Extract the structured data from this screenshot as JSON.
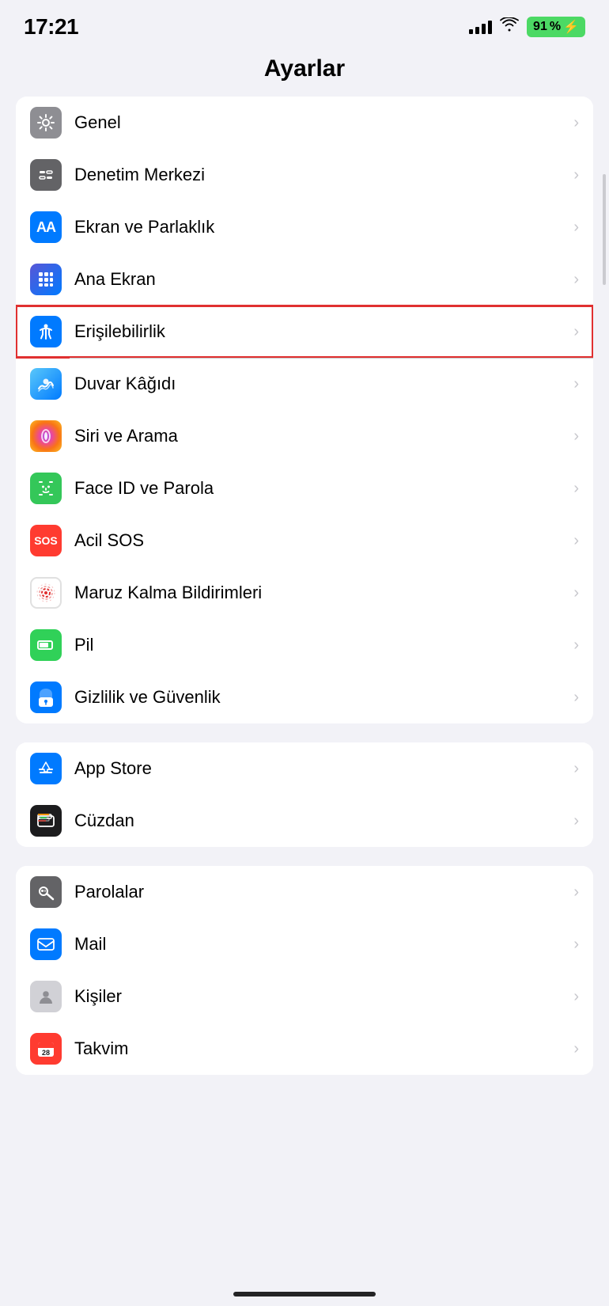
{
  "statusBar": {
    "time": "17:21",
    "battery": "91",
    "batteryIcon": "⚡"
  },
  "pageTitle": "Ayarlar",
  "sections": [
    {
      "id": "section1",
      "items": [
        {
          "id": "genel",
          "label": "Genel",
          "iconBg": "bg-gray",
          "iconType": "gear",
          "highlighted": false
        },
        {
          "id": "denetim-merkezi",
          "label": "Denetim Merkezi",
          "iconBg": "bg-gray2",
          "iconType": "toggles",
          "highlighted": false
        },
        {
          "id": "ekran-parlaklik",
          "label": "Ekran ve Parlaklık",
          "iconBg": "bg-blue",
          "iconType": "aa",
          "highlighted": false
        },
        {
          "id": "ana-ekran",
          "label": "Ana Ekran",
          "iconBg": "bg-blue2",
          "iconType": "grid",
          "highlighted": false
        },
        {
          "id": "erisilebilirlik",
          "label": "Erişilebilirlik",
          "iconBg": "bg-blue",
          "iconType": "accessibility",
          "highlighted": true
        },
        {
          "id": "duvar-kagidi",
          "label": "Duvar Kâğıdı",
          "iconBg": "bg-teal",
          "iconType": "flower",
          "highlighted": false
        },
        {
          "id": "siri-arama",
          "label": "Siri ve Arama",
          "iconBg": "bg-multicolor",
          "iconType": "siri",
          "highlighted": false
        },
        {
          "id": "face-id",
          "label": "Face ID ve Parola",
          "iconBg": "bg-green",
          "iconType": "faceid",
          "highlighted": false
        },
        {
          "id": "acil-sos",
          "label": "Acil SOS",
          "iconBg": "bg-red",
          "iconType": "sos",
          "highlighted": false
        },
        {
          "id": "maruz-kalma",
          "label": "Maruz Kalma Bildirimleri",
          "iconBg": "bg-gray",
          "iconType": "exposure",
          "highlighted": false
        },
        {
          "id": "pil",
          "label": "Pil",
          "iconBg": "bg-green2",
          "iconType": "battery",
          "highlighted": false
        },
        {
          "id": "gizlilik",
          "label": "Gizlilik ve Güvenlik",
          "iconBg": "bg-blue",
          "iconType": "hand",
          "highlighted": false
        }
      ]
    },
    {
      "id": "section2",
      "items": [
        {
          "id": "app-store",
          "label": "App Store",
          "iconBg": "bg-blue",
          "iconType": "appstore",
          "highlighted": false
        },
        {
          "id": "cuzdan",
          "label": "Cüzdan",
          "iconBg": "bg-dark",
          "iconType": "wallet",
          "highlighted": false
        }
      ]
    },
    {
      "id": "section3",
      "items": [
        {
          "id": "parolalar",
          "label": "Parolalar",
          "iconBg": "bg-gray2",
          "iconType": "key",
          "highlighted": false
        },
        {
          "id": "mail",
          "label": "Mail",
          "iconBg": "bg-blue",
          "iconType": "mail",
          "highlighted": false
        },
        {
          "id": "kisiler",
          "label": "Kişiler",
          "iconBg": "bg-gray",
          "iconType": "contacts",
          "highlighted": false
        },
        {
          "id": "takvim",
          "label": "Takvim",
          "iconBg": "bg-red",
          "iconType": "calendar",
          "highlighted": false
        }
      ]
    }
  ],
  "chevron": "›"
}
